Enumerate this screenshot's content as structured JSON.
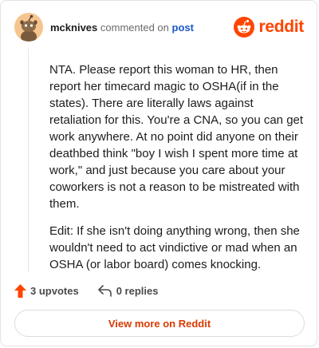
{
  "header": {
    "username": "mcknives",
    "commented_on": "commented on",
    "post_link": "post",
    "brand_wordmark": "reddit",
    "brand_color": "#ff4500"
  },
  "comment": {
    "paragraphs": [
      "NTA. Please report this woman to HR, then report her timecard magic to OSHA(if in the states). There are literally laws against retaliation for this. You're a CNA, so you can get work anywhere. At no point did anyone on their deathbed think \"boy I wish I spent more time at work,\" and just because you care about your coworkers is not a reason to be mistreated with them.",
      "Edit: If she isn't doing anything wrong, then she wouldn't need to act vindictive or mad when an OSHA (or labor board) comes knocking."
    ]
  },
  "actions": {
    "upvotes_label": "3 upvotes",
    "replies_label": "0 replies",
    "upvote_color": "#ff4500"
  },
  "footer": {
    "view_more_label": "View more on Reddit",
    "view_more_color": "#d93a00"
  },
  "icons": {
    "avatar": "snoo-avatar-icon",
    "brand": "reddit-logo-icon",
    "upvote": "upvote-arrow-icon",
    "reply": "reply-arrow-icon"
  }
}
